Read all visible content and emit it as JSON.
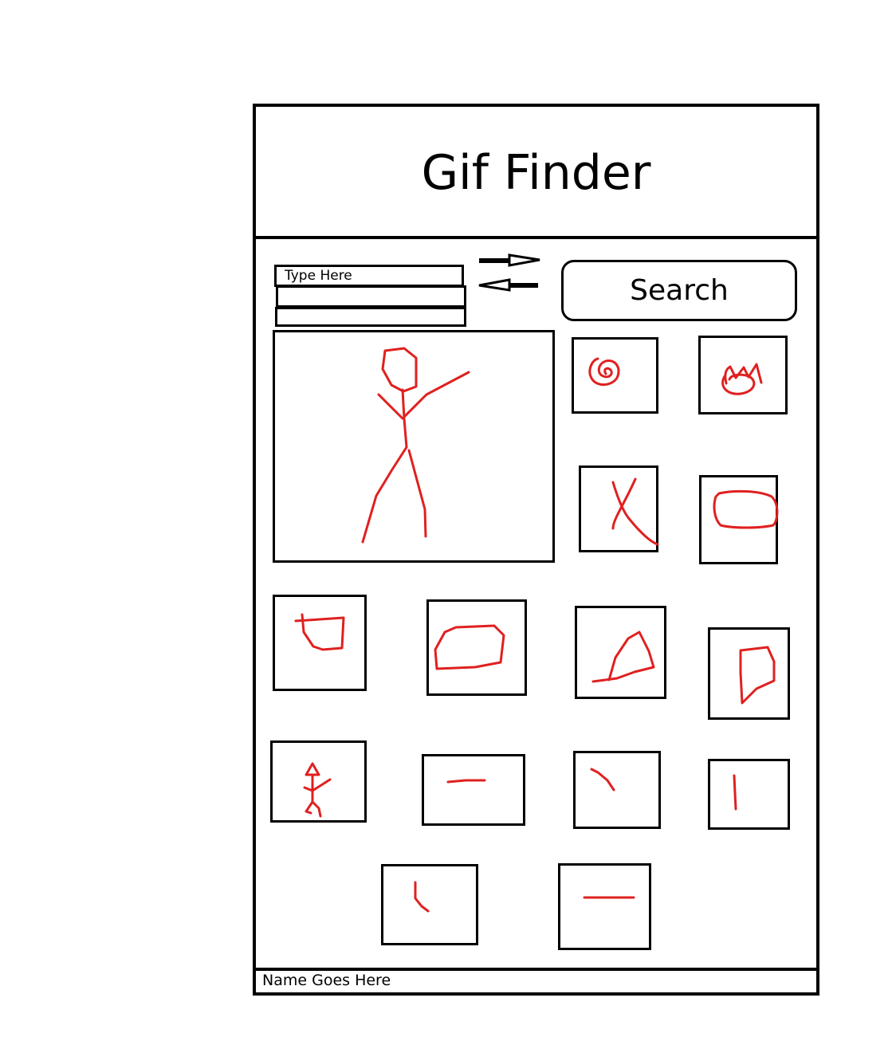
{
  "header": {
    "title": "Gif Finder"
  },
  "search": {
    "placeholder": "Type Here",
    "button_label": "Search",
    "arrow_right_icon": "arrow-right-icon",
    "arrow_left_icon": "arrow-left-icon"
  },
  "colors": {
    "stroke": "#000000",
    "sketch": "#e02020"
  },
  "footer": {
    "name_text": "Name Goes Here"
  }
}
